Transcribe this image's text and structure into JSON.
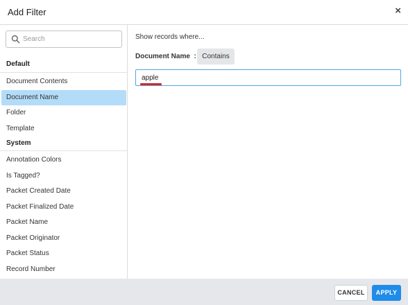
{
  "dialog": {
    "title": "Add Filter",
    "close_glyph": "×"
  },
  "sidebar": {
    "search_placeholder": "Search",
    "search_value": "",
    "groups": [
      {
        "label": "Default",
        "items": [
          {
            "label": "Document Contents",
            "selected": false
          },
          {
            "label": "Document Name",
            "selected": true
          },
          {
            "label": "Folder",
            "selected": false
          },
          {
            "label": "Template",
            "selected": false
          }
        ]
      },
      {
        "label": "System",
        "items": [
          {
            "label": "Annotation Colors",
            "selected": false
          },
          {
            "label": "Is Tagged?",
            "selected": false
          },
          {
            "label": "Packet Created Date",
            "selected": false
          },
          {
            "label": "Packet Finalized Date",
            "selected": false
          },
          {
            "label": "Packet Name",
            "selected": false
          },
          {
            "label": "Packet Originator",
            "selected": false
          },
          {
            "label": "Packet Status",
            "selected": false
          },
          {
            "label": "Record Number",
            "selected": false
          }
        ]
      }
    ]
  },
  "main": {
    "prompt": "Show records where...",
    "field_label": "Document Name",
    "separator": ":",
    "operator": "Contains",
    "value": "apple"
  },
  "footer": {
    "cancel_label": "CANCEL",
    "apply_label": "APPLY"
  },
  "colors": {
    "selected_item_bg": "#b3dcf9",
    "input_focus_border": "#4da7e6",
    "apply_bg": "#1f8cea",
    "spellcheck_underline": "#d9262a",
    "footer_bg": "#e5e7ea"
  },
  "icons": {
    "search": "search-icon",
    "close": "close-icon"
  }
}
